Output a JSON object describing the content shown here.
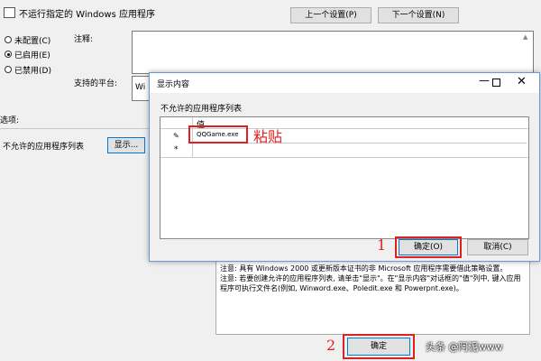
{
  "window": {
    "title": "不运行指定的 Windows 应用程序"
  },
  "nav": {
    "prev": "上一个设置(P)",
    "next": "下一个设置(N)"
  },
  "state": {
    "not_configured": "未配置(C)",
    "enabled": "已启用(E)",
    "disabled": "已禁用(D)"
  },
  "fields": {
    "comment_label": "注释:",
    "platform_label": "支持的平台:",
    "platform_value": "Wi"
  },
  "options": {
    "label": "选项:",
    "disallowed_label": "不允许的应用程序列表",
    "show_button": "显示..."
  },
  "dialog": {
    "title": "显示内容",
    "heading": "不允许的应用程序列表",
    "column_header": "值",
    "rows": [
      {
        "marker": "✎",
        "value": "QQGame.exe"
      },
      {
        "marker": "*",
        "value": ""
      }
    ],
    "ok": "确定(O)",
    "cancel": "取消(C)"
  },
  "help_text": {
    "line1": "注意: 具有 Windows 2000 或更新版本证书的非 Microsoft 应用程序需要借此策略设置。",
    "line2": "注意: 若要创建允许的应用程序列表, 请单击\"显示\"。在\"显示内容\"对话框的\"值\"列中, 键入应用程序可执行文件名(例如, Winword.exe、Poledit.exe 和 Powerpnt.exe)。"
  },
  "footer": {
    "ok": "确定"
  },
  "annotations": {
    "paste": "粘贴",
    "step1": "1",
    "step2": "2"
  },
  "watermark": "头条 @阿泥www"
}
